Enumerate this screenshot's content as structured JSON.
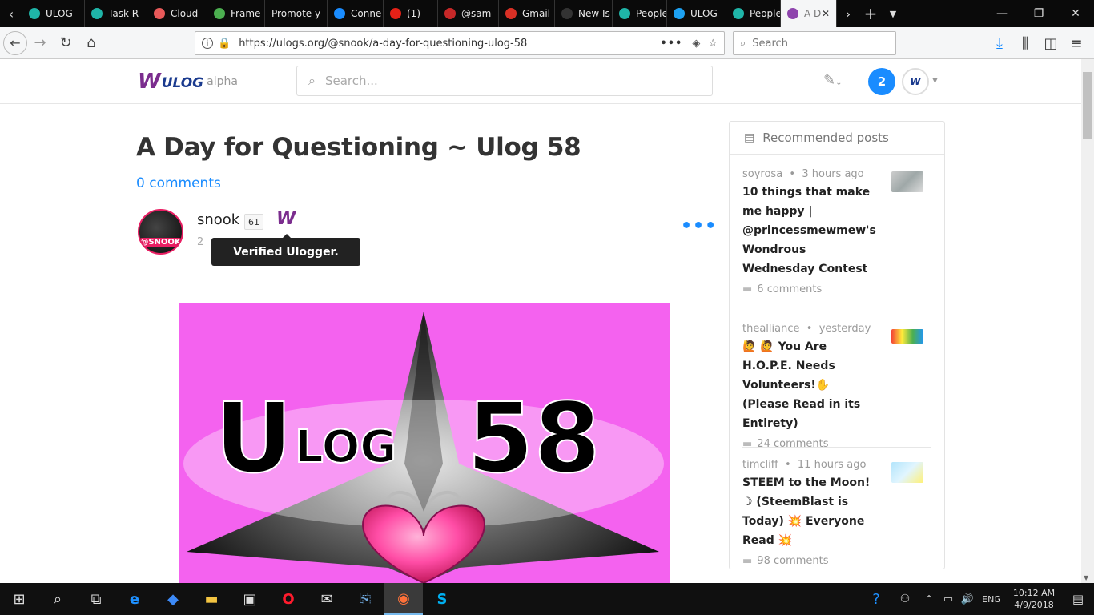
{
  "browser": {
    "tabs": [
      {
        "label": "ULOG",
        "color": "#1fb5a8"
      },
      {
        "label": "Task R",
        "color": "#1fb5a8"
      },
      {
        "label": "Cloud",
        "color": "#e85a5a"
      },
      {
        "label": "Frame",
        "color": "#4caf50"
      },
      {
        "label": "Promote y",
        "color": ""
      },
      {
        "label": "Conne",
        "color": "#1a8cff"
      },
      {
        "label": "(1)",
        "color": "#e62117"
      },
      {
        "label": "@sam",
        "color": "#c62828"
      },
      {
        "label": "Gmail",
        "color": "#d93025"
      },
      {
        "label": "New Is",
        "color": "#333333"
      },
      {
        "label": "People",
        "color": "#1fb5a8"
      },
      {
        "label": "ULOG",
        "color": "#1da1f2"
      },
      {
        "label": "People",
        "color": "#1fb5a8"
      },
      {
        "label": "A D",
        "color": "#8e44ad"
      }
    ],
    "url": "https://ulogs.org/@snook/a-day-for-questioning-ulog-58",
    "search_placeholder": "Search"
  },
  "site": {
    "logo_text": "ULOG",
    "logo_suffix": "alpha",
    "search_placeholder": "Search...",
    "notifications_count": "2"
  },
  "post": {
    "title": "A Day for Questioning ~ Ulog 58",
    "comments": "0 comments",
    "author": "snook",
    "reputation": "61",
    "avatar_text": "@SNOOK",
    "date_partial": "2",
    "tooltip": "Verified Ulogger.",
    "image_text_left": "U",
    "image_text_mid": "LOG",
    "image_text_right": "58"
  },
  "sidebar": {
    "heading": "Recommended posts",
    "items": [
      {
        "author": "soyrosa",
        "time": "3 hours ago",
        "title": "10 things that make me happy | @princessmewmew's Wondrous Wednesday Contest",
        "comments": "6 comments"
      },
      {
        "author": "thealliance",
        "time": "yesterday",
        "title": "🙋 🙋 You Are H.O.P.E. Needs Volunteers!✋ (Please Read in its Entirety)",
        "comments": "24 comments"
      },
      {
        "author": "timcliff",
        "time": "11 hours ago",
        "title": "STEEM to the Moon! ☽ (SteemBlast is Today) 💥 Everyone Read 💥",
        "comments": "98 comments"
      }
    ]
  },
  "taskbar": {
    "time": "10:12 AM",
    "date": "4/9/2018",
    "lang": "ENG"
  }
}
